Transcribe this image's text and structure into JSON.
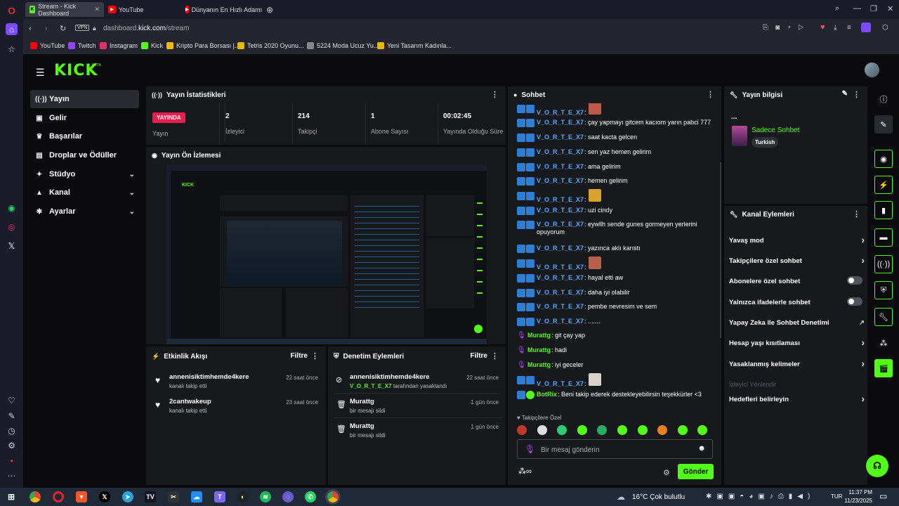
{
  "browser": {
    "tabs": [
      {
        "label": "Stream - Kick Dashboard"
      },
      {
        "label": "YouTube"
      },
      {
        "label": "Dünyanın En Hızlı Adamı"
      }
    ],
    "vpn": "VPN",
    "url_prefix": "dashboard.",
    "url_domain": "kick.com",
    "url_path": "/stream",
    "bookmarks": [
      "YouTube",
      "Twitch",
      "Instagram",
      "Kick",
      "Kripto Para Borsası |...",
      "Tetris 2020 Oyunu...",
      "5224 Moda Ucuz Yu...",
      "Yeni Tasarım Kadınla..."
    ]
  },
  "header": {
    "logo": "KICK",
    "beta": "BETA"
  },
  "nav": [
    {
      "label": "Yayın",
      "icon": "broadcast-icon"
    },
    {
      "label": "Gelir",
      "icon": "wallet-icon"
    },
    {
      "label": "Başarılar",
      "icon": "trophy-icon"
    },
    {
      "label": "Droplar ve Ödüller",
      "icon": "gift-icon"
    },
    {
      "label": "Stüdyo",
      "icon": "studio-icon"
    },
    {
      "label": "Kanal",
      "icon": "channel-icon"
    },
    {
      "label": "Ayarlar",
      "icon": "settings-icon"
    }
  ],
  "stats": {
    "title": "Yayın İstatistikleri",
    "status_badge": "YAYINDA",
    "status_label": "Yayın",
    "viewers": "2",
    "viewers_label": "İzleyici",
    "followers": "214",
    "followers_label": "Takipçi",
    "subs": "1",
    "subs_label": "Abone Sayısı",
    "uptime": "00:02:45",
    "uptime_label": "Yayında Olduğu Süre"
  },
  "preview": {
    "title": "Yayın Ön İzlemesi"
  },
  "activity": {
    "title": "Etkinlik Akışı",
    "filter": "Filtre",
    "items": [
      {
        "name": "annenisiktimhemde4kere",
        "desc": "kanalı takip etti",
        "time": "22 saat önce"
      },
      {
        "name": "2cantwakeup",
        "desc": "kanalı takip etti",
        "time": "23 saat önce"
      }
    ]
  },
  "moderation": {
    "title": "Denetim Eylemleri",
    "filter": "Filtre",
    "items": [
      {
        "name": "annenisiktimhemde4kere",
        "target": "V_O_R_T_E_X7",
        "desc": "tarafından yasaklandı",
        "time": "22 saat önce"
      },
      {
        "name": "Murattg",
        "desc": "bir mesajı sildi",
        "time": "1 gün önce"
      },
      {
        "name": "Murattg",
        "desc": "bir mesajı sildi",
        "time": "1 gün önce"
      }
    ]
  },
  "chat": {
    "title": "Sohbet",
    "messages": [
      {
        "user": "V_O_R_T_E_X7",
        "text": ":",
        "emote": "#c0594a"
      },
      {
        "user": "V_O_R_T_E_X7",
        "text": ": çay yapmayı gitcem kacıom yarın pabci 777"
      },
      {
        "user": "V_O_R_T_E_X7",
        "text": ": saat kacta gelcen"
      },
      {
        "user": "V_O_R_T_E_X7",
        "text": ": sen yaz hemen gelirim"
      },
      {
        "user": "V_O_R_T_E_X7",
        "text": ": ama gelirim"
      },
      {
        "user": "V_O_R_T_E_X7",
        "text": ": hemen gelirim"
      },
      {
        "user": "V_O_R_T_E_X7",
        "text": ":",
        "emote": "#d9a32a"
      },
      {
        "user": "V_O_R_T_E_X7",
        "text": ": uzi cindy"
      },
      {
        "user": "V_O_R_T_E_X7",
        "text": ": eywllh sende gunes gormeyen yerlerini opuyorum"
      },
      {
        "user": "V_O_R_T_E_X7",
        "text": ": yazınca aklı karıstı"
      },
      {
        "user": "V_O_R_T_E_X7",
        "text": ":",
        "emote": "#b7604c"
      },
      {
        "user": "V_O_R_T_E_X7",
        "text": ": hayal etti aw"
      },
      {
        "user": "V_O_R_T_E_X7",
        "text": ": daha iyi olabilir"
      },
      {
        "user": "V_O_R_T_E_X7",
        "text": ": pembe nevresim ve sem"
      },
      {
        "user": "V_O_R_T_E_X7",
        "text": ": ......."
      },
      {
        "user": "Murattg",
        "text": ": git çay yap",
        "role": "mod"
      },
      {
        "user": "Murattg",
        "text": ": hadi",
        "role": "mod"
      },
      {
        "user": "Murattg",
        "text": ": iyi geceler",
        "role": "mod"
      },
      {
        "user": "V_O_R_T_E_X7",
        "text": ":",
        "emote": "#d8d4cc"
      },
      {
        "user": "BotRix",
        "text": ": Beni takip ederek destekleyebilirsin teşekkürler <3",
        "role": "bot"
      }
    ],
    "followers_only": "Takipçilere Özel",
    "input_placeholder": "Bir mesaj gönderin",
    "send": "Gönder"
  },
  "stream_info": {
    "title": "Yayın bilgisi",
    "stream_title": "...",
    "category": "Sadece Sohbet",
    "tag": "Turkish"
  },
  "channel_actions": {
    "title": "Kanal Eylemleri",
    "items": [
      {
        "label": "Yavaş mod",
        "kind": "arrow"
      },
      {
        "label": "Takipçilere özel sohbet",
        "kind": "arrow"
      },
      {
        "label": "Abonelere özel sohbet",
        "kind": "toggle"
      },
      {
        "label": "Yalnızca ifadelerle sohbet",
        "kind": "toggle"
      },
      {
        "label": "Yapay Zeka ile Sohbet Denetimi",
        "kind": "external"
      },
      {
        "label": "Hesap yaşı kısıtlaması",
        "kind": "arrow"
      },
      {
        "label": "Yasaklanmış kelimeler",
        "kind": "arrow"
      },
      {
        "label": "İzleyici Yönlendir",
        "kind": "disabled"
      },
      {
        "label": "Hedefleri belirleyin",
        "kind": "arrow"
      }
    ]
  },
  "taskbar": {
    "weather": "16°C  Çok bulutlu",
    "lang": "TUR",
    "time": "11:37 PM",
    "date": "11/23/2025"
  },
  "colors": {
    "kick_green": "#53fc18",
    "panel": "#18191c",
    "live_red": "#e91e4f",
    "username_blue": "#54aaff"
  }
}
